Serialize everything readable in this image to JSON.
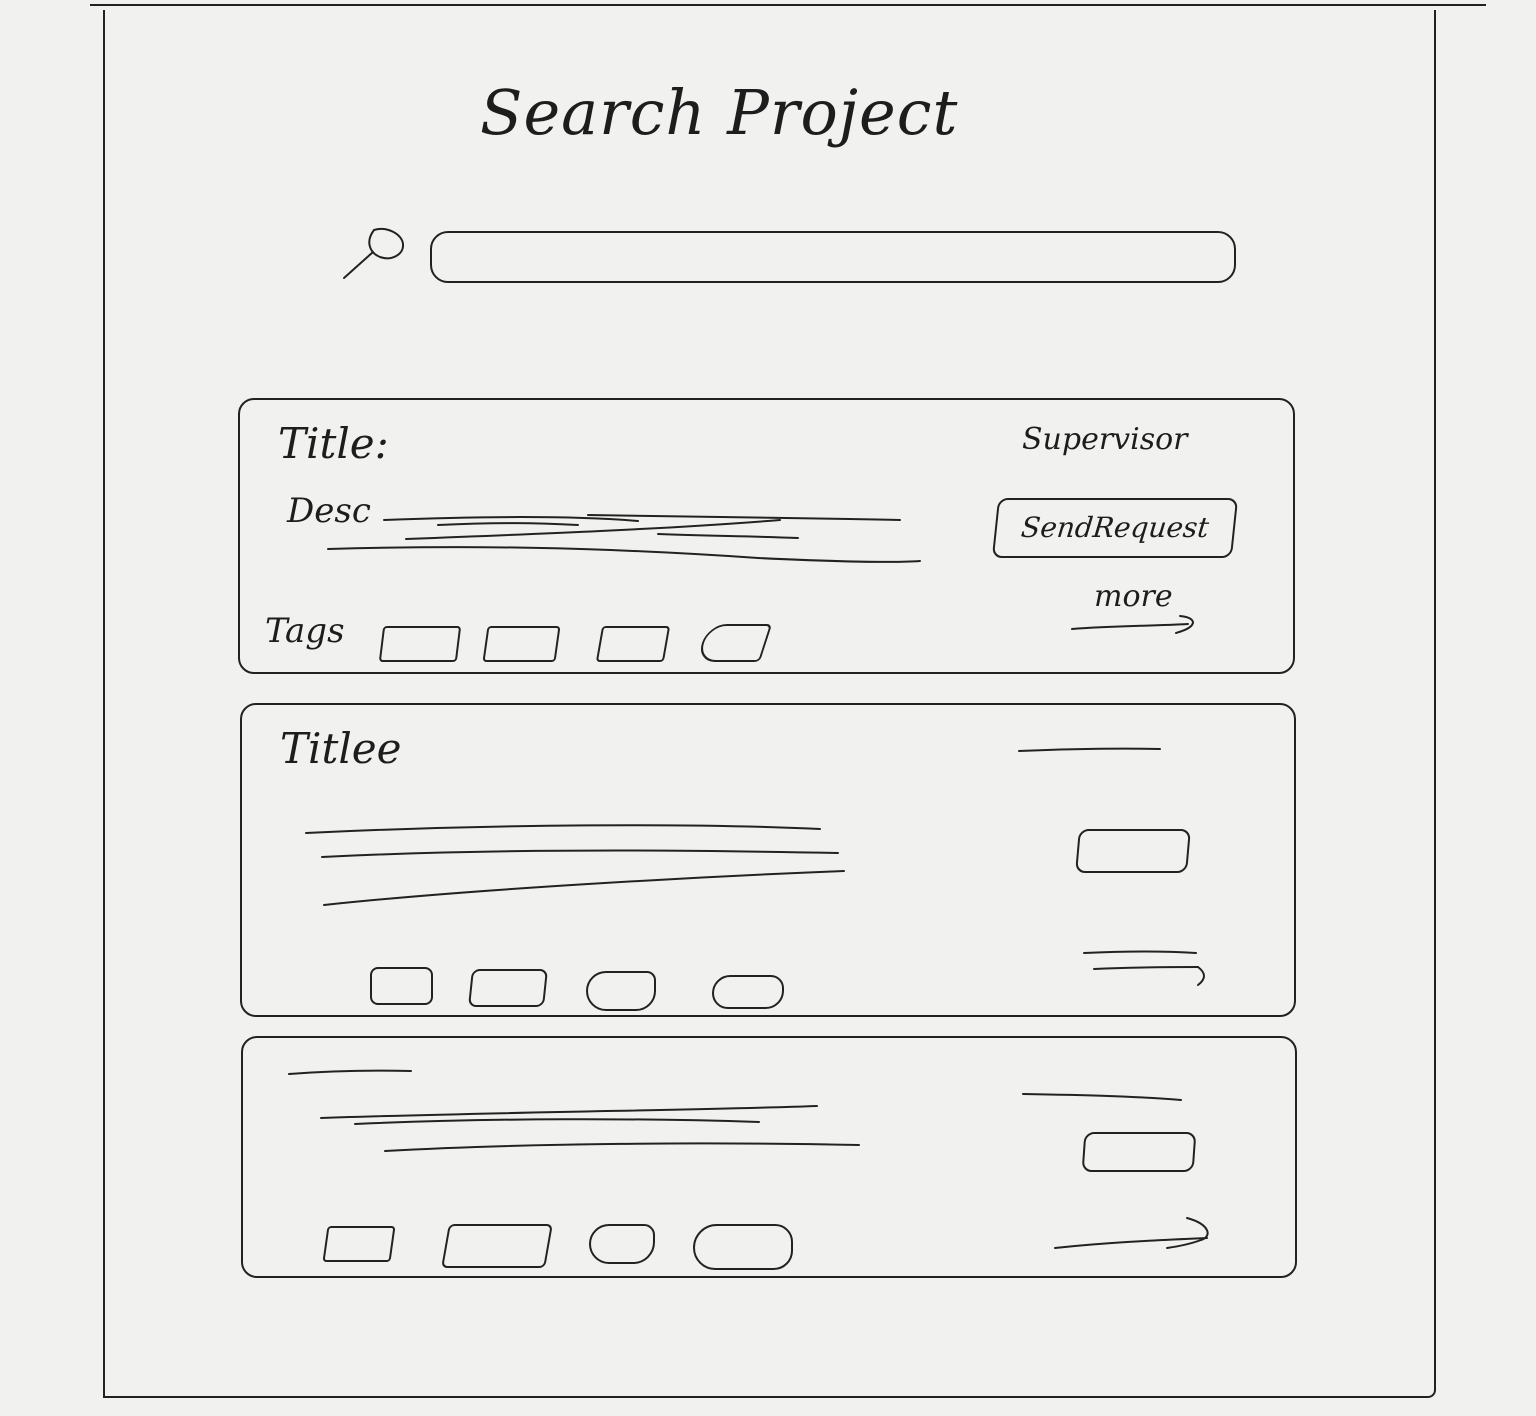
{
  "header": {
    "title": "Search Project"
  },
  "search": {
    "icon": "search-icon",
    "value": "",
    "placeholder": ""
  },
  "results": [
    {
      "title": "Title:",
      "description_label": "Desc",
      "tags_label": "Tags",
      "supervisor_label": "Supervisor",
      "send_request_label": "SendRequest",
      "more_label": "more"
    },
    {
      "title": "Titlee"
    },
    {
      "title": ""
    }
  ]
}
